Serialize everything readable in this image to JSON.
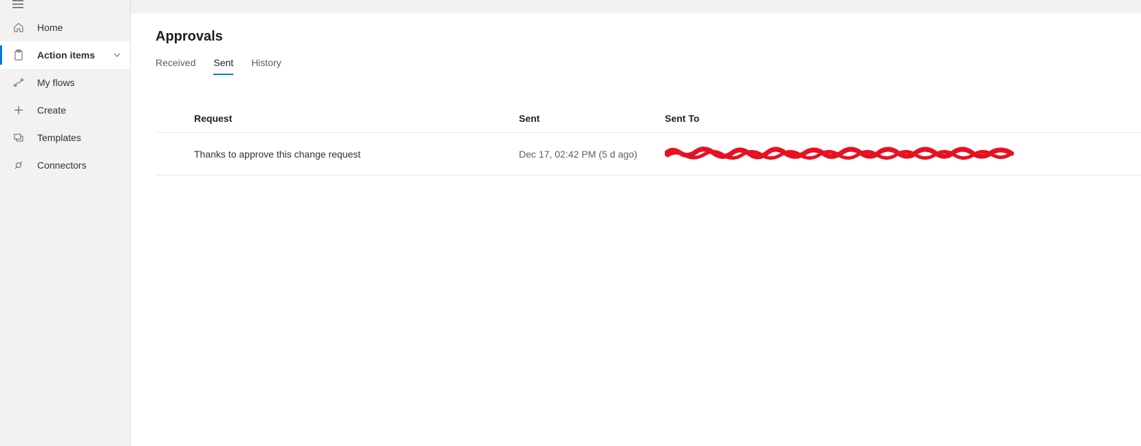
{
  "sidebar": {
    "items": [
      {
        "label": "Home"
      },
      {
        "label": "Action items"
      },
      {
        "label": "My flows"
      },
      {
        "label": "Create"
      },
      {
        "label": "Templates"
      },
      {
        "label": "Connectors"
      }
    ]
  },
  "page": {
    "title": "Approvals"
  },
  "tabs": [
    {
      "label": "Received"
    },
    {
      "label": "Sent"
    },
    {
      "label": "History"
    }
  ],
  "table": {
    "headers": {
      "request": "Request",
      "sent": "Sent",
      "sent_to": "Sent To"
    },
    "rows": [
      {
        "request": "Thanks to approve this change request",
        "sent": "Dec 17, 02:42 PM (5 d ago)",
        "sent_to": "[redacted]"
      }
    ]
  }
}
